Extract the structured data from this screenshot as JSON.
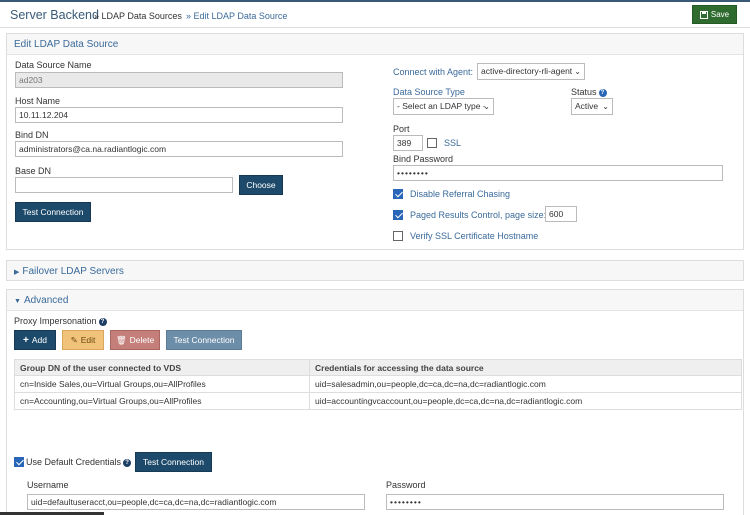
{
  "header": {
    "app_title": "Server Backend",
    "crumb1": "» LDAP Data Sources",
    "crumb2": "» Edit LDAP Data Source",
    "save_label": "Save"
  },
  "edit_panel": {
    "title": "Edit LDAP Data Source",
    "data_source_name_label": "Data Source Name",
    "data_source_name_value": "ad203",
    "host_name_label": "Host Name",
    "host_name_value": "10.11.12.204",
    "bind_dn_label": "Bind DN",
    "bind_dn_value": "administrators@ca.na.radiantlogic.com",
    "base_dn_label": "Base DN",
    "base_dn_value": "",
    "choose_label": "Choose",
    "test_connection_label": "Test Connection",
    "connect_with_agent_label": "Connect with Agent:",
    "agent_value": "active-directory-rli-agent",
    "data_source_type_label": "Data Source Type",
    "data_source_type_value": "- Select an LDAP type -",
    "status_label": "Status",
    "status_value": "Active",
    "port_label": "Port",
    "port_value": "389",
    "ssl_label": "SSL",
    "ssl_checked": false,
    "bind_password_label": "Bind Password",
    "bind_password_value": "••••••••",
    "disable_referral_label": "Disable Referral Chasing",
    "disable_referral_checked": true,
    "paged_results_label": "Paged Results Control, page size:",
    "paged_results_checked": true,
    "page_size_value": "600",
    "verify_ssl_label": "Verify SSL Certificate Hostname",
    "verify_ssl_checked": false
  },
  "failover": {
    "title": "Failover LDAP Servers"
  },
  "advanced": {
    "title": "Advanced",
    "proxy_label": "Proxy Impersonation",
    "add_label": "Add",
    "edit_label": "Edit",
    "delete_label": "Delete",
    "test_connection_label": "Test Connection",
    "table": {
      "headers": [
        "Group DN of the user connected to VDS",
        "Credentials for accessing the data source"
      ],
      "rows": [
        [
          "cn=Inside Sales,ou=Virtual Groups,ou=AllProfiles",
          "uid=salesadmin,ou=people,dc=ca,dc=na,dc=radiantlogic.com"
        ],
        [
          "cn=Accounting,ou=Virtual Groups,ou=AllProfiles",
          "uid=accountingvcaccount,ou=people,dc=ca,dc=na,dc=radiantlogic.com"
        ]
      ]
    },
    "use_default_label": "Use Default Credentials",
    "use_default_checked": true,
    "test_connection2_label": "Test Connection",
    "username_label": "Username",
    "username_value": "uid=defaultuseracct,ou=people,dc=ca,dc=na,dc=radiantlogic.com",
    "password_label": "Password",
    "password_value": "••••••••"
  }
}
